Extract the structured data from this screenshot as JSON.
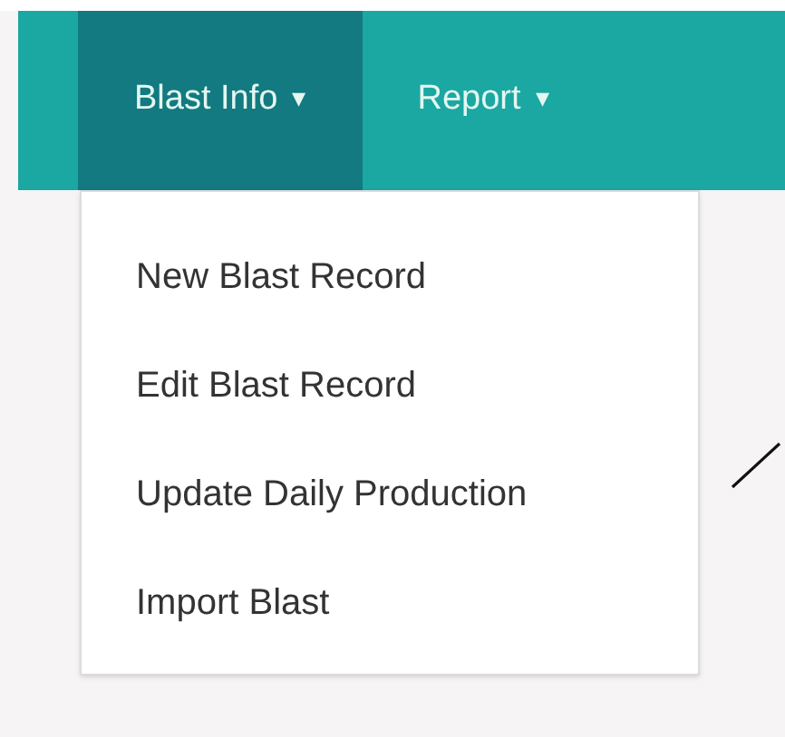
{
  "navbar": {
    "menus": [
      {
        "label": "Blast Info",
        "caret": "▾",
        "selected": true
      },
      {
        "label": "Report",
        "caret": "▾",
        "selected": false
      }
    ]
  },
  "dropdown": {
    "items": [
      {
        "label": "New Blast Record"
      },
      {
        "label": "Edit Blast Record"
      },
      {
        "label": "Update Daily Production"
      },
      {
        "label": "Import Blast"
      }
    ]
  }
}
